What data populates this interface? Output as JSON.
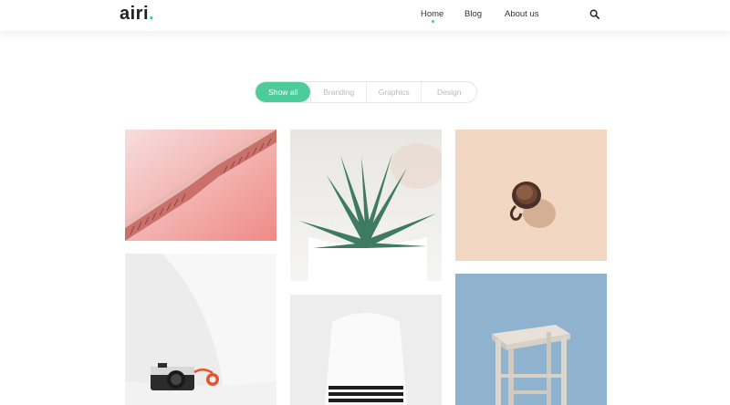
{
  "header": {
    "logo_text": "airi",
    "logo_dot": ".",
    "nav": [
      {
        "label": "Home",
        "active": true
      },
      {
        "label": "Blog",
        "active": false
      },
      {
        "label": "About us",
        "active": false
      }
    ],
    "search_icon": "search-icon"
  },
  "filters": {
    "items": [
      "Show all",
      "Branding",
      "Graphics",
      "Design"
    ],
    "active_index": 0
  },
  "portfolio": {
    "items": [
      {
        "image": "escalator-photo"
      },
      {
        "image": "aloe-plant-photo"
      },
      {
        "image": "coffee-cup-photo"
      },
      {
        "image": "camera-on-chair-photo"
      },
      {
        "image": "chair-with-striped-cloth-photo"
      },
      {
        "image": "wooden-stool-photo"
      }
    ]
  },
  "colors": {
    "accent": "#4ecb9a",
    "text": "#222222",
    "muted": "#b9b9b9"
  }
}
